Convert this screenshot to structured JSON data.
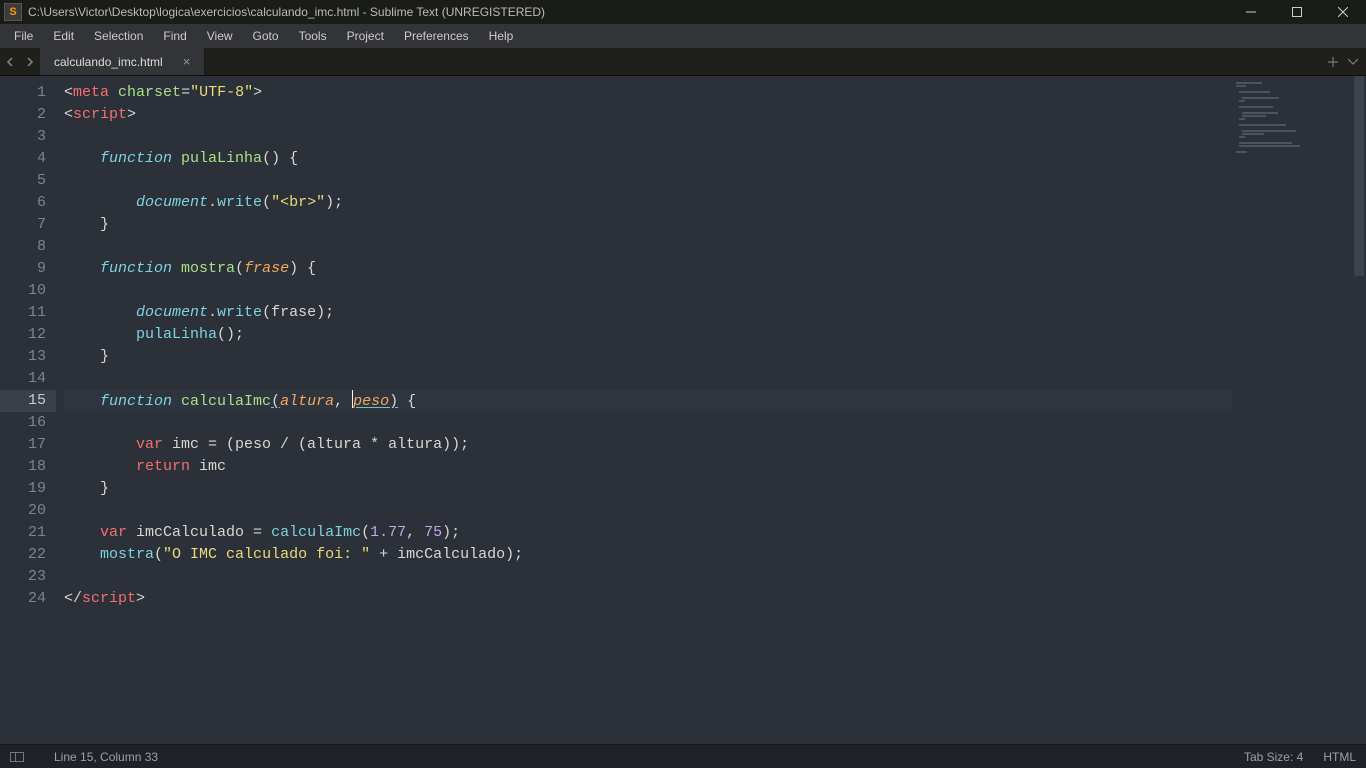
{
  "window": {
    "title": "C:\\Users\\Victor\\Desktop\\logica\\exercicios\\calculando_imc.html - Sublime Text (UNREGISTERED)"
  },
  "menu": {
    "items": [
      "File",
      "Edit",
      "Selection",
      "Find",
      "View",
      "Goto",
      "Tools",
      "Project",
      "Preferences",
      "Help"
    ]
  },
  "tabs": {
    "active": "calculando_imc.html"
  },
  "status": {
    "position": "Line 15, Column 33",
    "tab_size": "Tab Size: 4",
    "syntax": "HTML"
  },
  "editor": {
    "current_line": 15,
    "line_count": 24,
    "cursor": {
      "line": 15,
      "col": 33
    },
    "lines": [
      {
        "n": 1,
        "tokens": [
          {
            "t": "<",
            "c": "c-punc"
          },
          {
            "t": "meta",
            "c": "c-tag"
          },
          {
            "t": " ",
            "c": "c-plain"
          },
          {
            "t": "charset",
            "c": "c-attr"
          },
          {
            "t": "=",
            "c": "c-punc"
          },
          {
            "t": "\"UTF-8\"",
            "c": "c-string"
          },
          {
            "t": ">",
            "c": "c-punc"
          }
        ]
      },
      {
        "n": 2,
        "tokens": [
          {
            "t": "<",
            "c": "c-punc"
          },
          {
            "t": "script",
            "c": "c-tag"
          },
          {
            "t": ">",
            "c": "c-punc"
          }
        ]
      },
      {
        "n": 3,
        "tokens": []
      },
      {
        "n": 4,
        "indent": 1,
        "tokens": [
          {
            "t": "function",
            "c": "c-storage"
          },
          {
            "t": " ",
            "c": "c-plain"
          },
          {
            "t": "pulaLinha",
            "c": "c-funcname"
          },
          {
            "t": "() {",
            "c": "c-punc"
          }
        ]
      },
      {
        "n": 5,
        "tokens": []
      },
      {
        "n": 6,
        "indent": 2,
        "tokens": [
          {
            "t": "document",
            "c": "c-builtin"
          },
          {
            "t": ".",
            "c": "c-punc"
          },
          {
            "t": "write",
            "c": "c-method"
          },
          {
            "t": "(",
            "c": "c-punc"
          },
          {
            "t": "\"<br>\"",
            "c": "c-string"
          },
          {
            "t": ");",
            "c": "c-punc"
          }
        ]
      },
      {
        "n": 7,
        "indent": 1,
        "tokens": [
          {
            "t": "}",
            "c": "c-punc"
          }
        ]
      },
      {
        "n": 8,
        "tokens": []
      },
      {
        "n": 9,
        "indent": 1,
        "tokens": [
          {
            "t": "function",
            "c": "c-storage"
          },
          {
            "t": " ",
            "c": "c-plain"
          },
          {
            "t": "mostra",
            "c": "c-funcname"
          },
          {
            "t": "(",
            "c": "c-punc"
          },
          {
            "t": "frase",
            "c": "c-param"
          },
          {
            "t": ") {",
            "c": "c-punc"
          }
        ]
      },
      {
        "n": 10,
        "tokens": []
      },
      {
        "n": 11,
        "indent": 2,
        "tokens": [
          {
            "t": "document",
            "c": "c-builtin"
          },
          {
            "t": ".",
            "c": "c-punc"
          },
          {
            "t": "write",
            "c": "c-method"
          },
          {
            "t": "(frase);",
            "c": "c-punc"
          }
        ]
      },
      {
        "n": 12,
        "indent": 2,
        "tokens": [
          {
            "t": "pulaLinha",
            "c": "c-method"
          },
          {
            "t": "();",
            "c": "c-punc"
          }
        ]
      },
      {
        "n": 13,
        "indent": 1,
        "tokens": [
          {
            "t": "}",
            "c": "c-punc"
          }
        ]
      },
      {
        "n": 14,
        "tokens": []
      },
      {
        "n": 15,
        "indent": 1,
        "tokens": [
          {
            "t": "function",
            "c": "c-storage"
          },
          {
            "t": " ",
            "c": "c-plain"
          },
          {
            "t": "calculaImc",
            "c": "c-funcname"
          },
          {
            "t": "(",
            "c": "c-punc underline"
          },
          {
            "t": "altura",
            "c": "c-param"
          },
          {
            "t": ", ",
            "c": "c-punc"
          },
          {
            "t": "",
            "cursor": true
          },
          {
            "t": "peso",
            "c": "c-param underline"
          },
          {
            "t": ")",
            "c": "c-punc underline"
          },
          {
            "t": " {",
            "c": "c-punc"
          }
        ]
      },
      {
        "n": 16,
        "tokens": []
      },
      {
        "n": 17,
        "indent": 2,
        "tokens": [
          {
            "t": "var",
            "c": "c-key"
          },
          {
            "t": " imc = (peso / (altura * altura));",
            "c": "c-plain"
          }
        ]
      },
      {
        "n": 18,
        "indent": 2,
        "tokens": [
          {
            "t": "return",
            "c": "c-key"
          },
          {
            "t": " imc",
            "c": "c-plain"
          }
        ]
      },
      {
        "n": 19,
        "indent": 1,
        "tokens": [
          {
            "t": "}",
            "c": "c-punc"
          }
        ]
      },
      {
        "n": 20,
        "tokens": []
      },
      {
        "n": 21,
        "indent": 1,
        "tokens": [
          {
            "t": "var",
            "c": "c-key"
          },
          {
            "t": " imcCalculado = ",
            "c": "c-plain"
          },
          {
            "t": "calculaImc",
            "c": "c-method"
          },
          {
            "t": "(",
            "c": "c-punc"
          },
          {
            "t": "1.77",
            "c": "c-num"
          },
          {
            "t": ", ",
            "c": "c-punc"
          },
          {
            "t": "75",
            "c": "c-num"
          },
          {
            "t": ");",
            "c": "c-punc"
          }
        ]
      },
      {
        "n": 22,
        "indent": 1,
        "tokens": [
          {
            "t": "mostra",
            "c": "c-method"
          },
          {
            "t": "(",
            "c": "c-punc"
          },
          {
            "t": "\"O IMC calculado foi: \"",
            "c": "c-string"
          },
          {
            "t": " + imcCalculado);",
            "c": "c-plain"
          }
        ]
      },
      {
        "n": 23,
        "tokens": []
      },
      {
        "n": 24,
        "tokens": [
          {
            "t": "</",
            "c": "c-punc"
          },
          {
            "t": "script",
            "c": "c-tag"
          },
          {
            "t": ">",
            "c": "c-punc"
          }
        ]
      }
    ]
  }
}
